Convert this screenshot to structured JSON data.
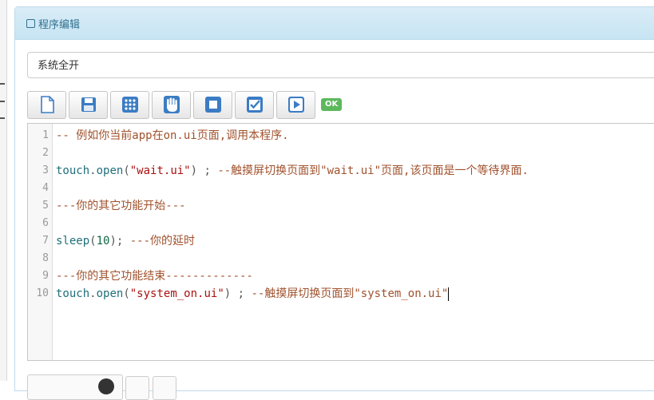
{
  "panel": {
    "title": "程序编辑"
  },
  "program_select": {
    "value": "系统全开"
  },
  "toolbar": {
    "buttons": [
      "new-file-icon",
      "save-icon",
      "grid-icon",
      "hand-stop-icon",
      "stop-square-icon",
      "checkbox-icon",
      "play-icon"
    ],
    "status_badge": "OK"
  },
  "editor": {
    "lines": [
      {
        "num": "1",
        "tokens": [
          {
            "t": "-- 例如你当前app在on.ui页面,调用本程序.",
            "c": "cm"
          }
        ]
      },
      {
        "num": "2",
        "tokens": []
      },
      {
        "num": "3",
        "tokens": [
          {
            "t": "touch",
            "c": "kw"
          },
          {
            "t": ".",
            "c": "pun"
          },
          {
            "t": "open",
            "c": "kw"
          },
          {
            "t": "(",
            "c": "pun"
          },
          {
            "t": "\"wait.ui\"",
            "c": "str"
          },
          {
            "t": ") ; ",
            "c": "pun"
          },
          {
            "t": "--触摸屏切换页面到\"wait.ui\"页面,该页面是一个等待界面.",
            "c": "cm"
          }
        ]
      },
      {
        "num": "4",
        "tokens": []
      },
      {
        "num": "5",
        "tokens": [
          {
            "t": "---你的其它功能开始---",
            "c": "cm"
          }
        ]
      },
      {
        "num": "6",
        "tokens": []
      },
      {
        "num": "7",
        "tokens": [
          {
            "t": "sleep",
            "c": "kw"
          },
          {
            "t": "(",
            "c": "pun"
          },
          {
            "t": "10",
            "c": "num"
          },
          {
            "t": "); ",
            "c": "pun"
          },
          {
            "t": "---你的延时",
            "c": "cm"
          }
        ]
      },
      {
        "num": "8",
        "tokens": []
      },
      {
        "num": "9",
        "tokens": [
          {
            "t": "---你的其它功能结束-------------",
            "c": "cm"
          }
        ]
      },
      {
        "num": "10",
        "tokens": [
          {
            "t": "touch",
            "c": "kw"
          },
          {
            "t": ".",
            "c": "pun"
          },
          {
            "t": "open",
            "c": "kw"
          },
          {
            "t": "(",
            "c": "pun"
          },
          {
            "t": "\"system_on.ui\"",
            "c": "str"
          },
          {
            "t": ") ; ",
            "c": "pun"
          },
          {
            "t": "--触摸屏切换页面到\"system_on.ui\"",
            "c": "cm"
          }
        ]
      }
    ]
  }
}
